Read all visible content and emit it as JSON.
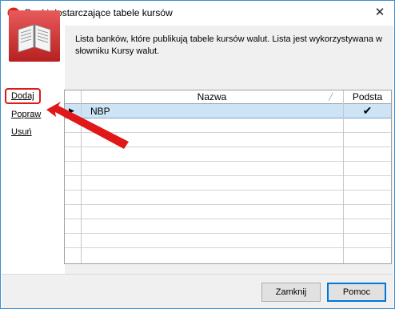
{
  "window": {
    "title": "Banki dostarczające tabele kursów",
    "close_glyph": "✕"
  },
  "description": "Lista banków, które publikują tabele kursów walut. Lista jest wykorzystywana w słowniku Kursy walut.",
  "sidebar": {
    "links": [
      {
        "label": "Dodaj"
      },
      {
        "label": "Popraw"
      },
      {
        "label": "Usuń"
      }
    ]
  },
  "grid": {
    "columns": [
      "Nazwa",
      "Podsta"
    ],
    "rows": [
      {
        "name": "NBP",
        "default_mark": "✔",
        "selected": true
      }
    ],
    "row_indicator": "▶"
  },
  "buttons": {
    "close_label": "Zamknij",
    "help_label": "Pomoc"
  },
  "annotation": {
    "color": "#e01818"
  }
}
